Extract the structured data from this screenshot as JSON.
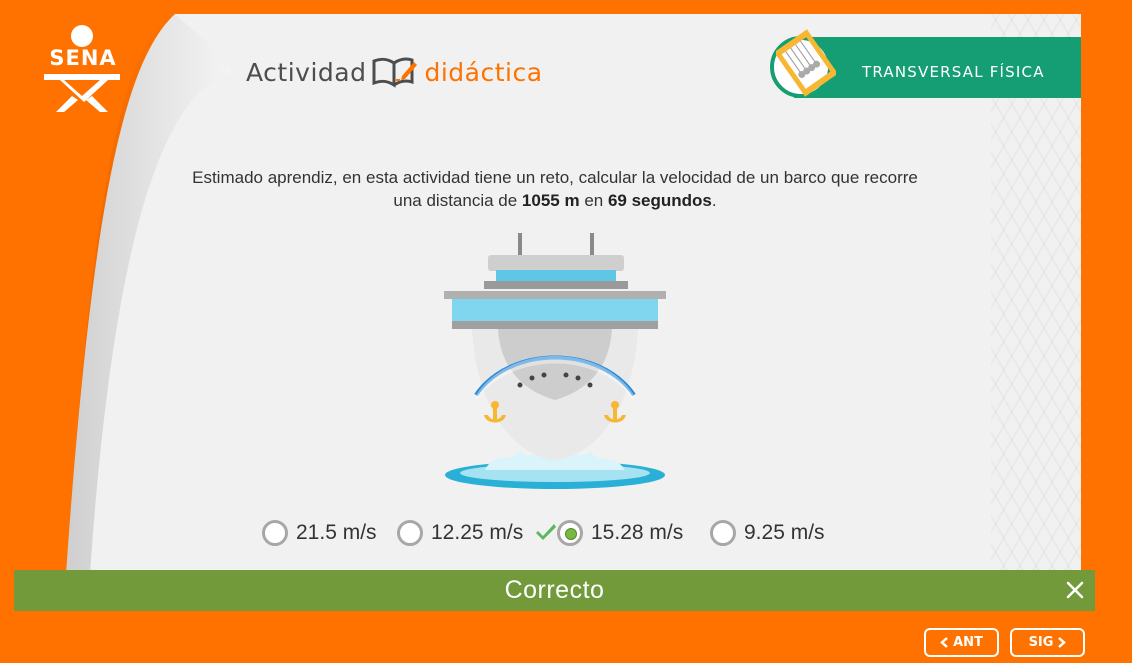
{
  "brand": {
    "logo_text": "SENA"
  },
  "header": {
    "title_part1": "Actividad",
    "title_part2": "didáctica",
    "badge_label": "TRANSVERSAL FÍSICA"
  },
  "question": {
    "line1": "Estimado aprendiz, en esta actividad tiene un reto, calcular la velocidad de un barco que recorre",
    "line2_pre": "una distancia de ",
    "distance": "1055 m",
    "line2_mid": " en ",
    "time": "69 segundos",
    "line2_end": "."
  },
  "options": [
    {
      "label": "21.5 m/s",
      "selected": false
    },
    {
      "label": "12.25 m/s",
      "selected": false
    },
    {
      "label": "15.28 m/s",
      "selected": true,
      "correct": true
    },
    {
      "label": "9.25 m/s",
      "selected": false
    }
  ],
  "feedback": {
    "text": "Correcto"
  },
  "nav": {
    "prev": "ANT",
    "next": "SIG"
  },
  "colors": {
    "accent_orange": "#ff7200",
    "badge_green": "#159e73",
    "feedback_green": "#729a3b",
    "check_green": "#5cb85c"
  }
}
